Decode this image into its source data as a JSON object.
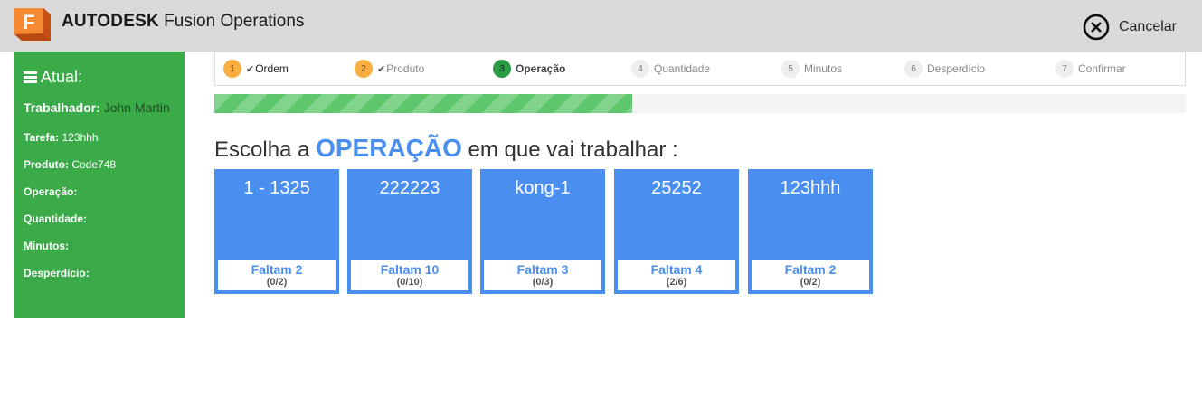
{
  "header": {
    "brand": "AUTODESK",
    "product": "Fusion Operations",
    "logo_letter": "F",
    "cancel_label": "Cancelar"
  },
  "sidebar": {
    "title": "Atual:",
    "worker_label": "Trabalhador:",
    "worker_value": "John Martin",
    "rows": [
      {
        "label": "Tarefa:",
        "value": "123hhh"
      },
      {
        "label": "Produto:",
        "value": "Code748"
      },
      {
        "label": "Operação:",
        "value": ""
      },
      {
        "label": "Quantidade:",
        "value": ""
      },
      {
        "label": "Minutos:",
        "value": ""
      },
      {
        "label": "Desperdício:",
        "value": ""
      }
    ]
  },
  "steps": [
    {
      "num": "1",
      "label": "Ordem",
      "state": "done"
    },
    {
      "num": "2",
      "label": "Produto",
      "state": "done"
    },
    {
      "num": "3",
      "label": "Operação",
      "state": "active"
    },
    {
      "num": "4",
      "label": "Quantidade",
      "state": "pending"
    },
    {
      "num": "5",
      "label": "Minutos",
      "state": "pending"
    },
    {
      "num": "6",
      "label": "Desperdício",
      "state": "pending"
    },
    {
      "num": "7",
      "label": "Confirmar",
      "state": "pending"
    }
  ],
  "progress": {
    "fraction": 0.43
  },
  "heading": {
    "prefix": "Escolha a",
    "emphasis": "OPERAÇÃO",
    "suffix": "em que vai trabalhar :"
  },
  "operations": [
    {
      "name": "1 - 1325",
      "remaining": "Faltam 2",
      "ratio": "(0/2)"
    },
    {
      "name": "222223",
      "remaining": "Faltam 10",
      "ratio": "(0/10)"
    },
    {
      "name": "kong-1",
      "remaining": "Faltam 3",
      "ratio": "(0/3)"
    },
    {
      "name": "25252",
      "remaining": "Faltam 4",
      "ratio": "(2/6)"
    },
    {
      "name": "123hhh",
      "remaining": "Faltam 2",
      "ratio": "(0/2)"
    }
  ],
  "colors": {
    "topbar": "#d9d9d9",
    "sidebar": "#3aab48",
    "accent_blue": "#4a8ff0",
    "step_done": "#f9ae41",
    "step_active": "#2b9a44",
    "progress": "#5fc76b"
  }
}
